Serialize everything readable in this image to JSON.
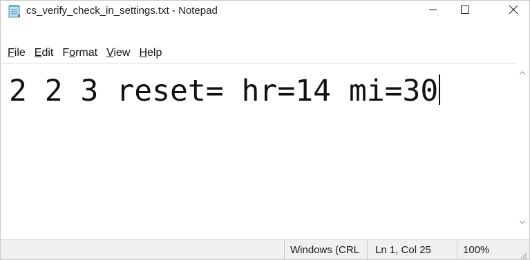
{
  "window": {
    "title": "cs_verify_check_in_settings.txt - Notepad",
    "icons": {
      "app": "notepad-icon",
      "minimize": "minimize-icon",
      "maximize": "maximize-icon",
      "close": "close-icon"
    }
  },
  "menu": {
    "items": [
      {
        "key": "F",
        "rest": "ile"
      },
      {
        "key": "E",
        "rest": "dit"
      },
      {
        "pre": "F",
        "key": "o",
        "rest": "rmat"
      },
      {
        "key": "V",
        "rest": "iew"
      },
      {
        "key": "H",
        "rest": "elp"
      }
    ]
  },
  "editor": {
    "content": "2 2 3 reset= hr=14 mi=30"
  },
  "scrollbar": {
    "up_icon": "scroll-up-arrow-icon",
    "down_icon": "scroll-down-arrow-icon"
  },
  "status": {
    "encoding": "Windows (CRLF)",
    "position": "Ln 1, Col 25",
    "zoom": "100%"
  },
  "colors": {
    "background": "#ffffff",
    "statusbar": "#f0f0f0",
    "text": "#111111"
  }
}
